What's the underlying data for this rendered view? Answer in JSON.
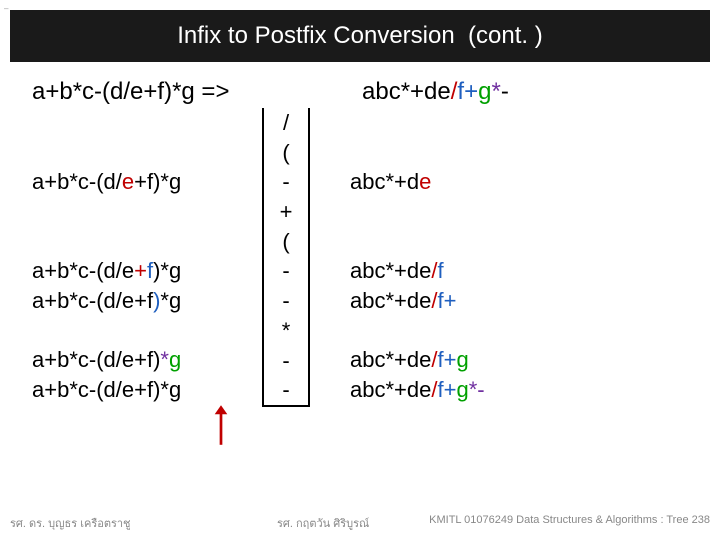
{
  "title": "Infix to Postfix Conversion  (cont. )",
  "tiny": "–",
  "header": {
    "expr_arrow": "a+b*c-(d/e+f)*g =>",
    "result_parts": [
      {
        "t": "abc*+de",
        "c": "hl-black"
      },
      {
        "t": "/",
        "c": "hl-red"
      },
      {
        "t": "f+",
        "c": "hl-blue"
      },
      {
        "t": "g",
        "c": "hl-green"
      },
      {
        "t": "*",
        "c": "hl-purple"
      },
      {
        "t": "-",
        "c": "hl-black"
      }
    ]
  },
  "rows": [
    {
      "left_parts": [],
      "stack": "/",
      "boxed": true,
      "right_parts": []
    },
    {
      "left_parts": [],
      "stack": "(",
      "boxed": true,
      "right_parts": []
    },
    {
      "left_parts": [
        {
          "t": "a+b*c-(d/",
          "c": "hl-black"
        },
        {
          "t": "e",
          "c": "hl-red"
        },
        {
          "t": "+f)*g",
          "c": "hl-black"
        }
      ],
      "stack": "-",
      "boxed": true,
      "right_parts": [
        {
          "t": "abc*+d",
          "c": "hl-black"
        },
        {
          "t": "e",
          "c": "hl-red"
        }
      ]
    },
    {
      "left_parts": [],
      "stack": "+",
      "boxed": true,
      "right_parts": []
    },
    {
      "left_parts": [],
      "stack": "(",
      "boxed": true,
      "right_parts": []
    },
    {
      "left_parts": [
        {
          "t": "a+b*c-(d/e",
          "c": "hl-black"
        },
        {
          "t": "+",
          "c": "hl-red"
        },
        {
          "t": "f",
          "c": "hl-blue"
        },
        {
          "t": ")*g",
          "c": "hl-black"
        }
      ],
      "stack": "-",
      "boxed": true,
      "right_parts": [
        {
          "t": "abc*+de",
          "c": "hl-black"
        },
        {
          "t": "/",
          "c": "hl-red"
        },
        {
          "t": "f",
          "c": "hl-blue"
        }
      ]
    },
    {
      "left_parts": [
        {
          "t": "a+b*c-(d/e+f",
          "c": "hl-black"
        },
        {
          "t": ")",
          "c": "hl-blue"
        },
        {
          "t": "*g",
          "c": "hl-black"
        }
      ],
      "stack": "-",
      "boxed": true,
      "right_parts": [
        {
          "t": "abc*+de",
          "c": "hl-black"
        },
        {
          "t": "/",
          "c": "hl-red"
        },
        {
          "t": "f",
          "c": "hl-blue"
        },
        {
          "t": "+",
          "c": "hl-blue"
        }
      ]
    },
    {
      "left_parts": [],
      "stack": "*",
      "boxed": true,
      "right_parts": []
    },
    {
      "left_parts": [
        {
          "t": "a+b*c-(d/e+f)",
          "c": "hl-black"
        },
        {
          "t": "*",
          "c": "hl-purple"
        },
        {
          "t": "g",
          "c": "hl-green"
        }
      ],
      "stack": "-",
      "boxed": true,
      "right_parts": [
        {
          "t": "abc*+de",
          "c": "hl-black"
        },
        {
          "t": "/",
          "c": "hl-red"
        },
        {
          "t": "f+",
          "c": "hl-blue"
        },
        {
          "t": "g",
          "c": "hl-green"
        }
      ]
    },
    {
      "left_parts": [
        {
          "t": "a+b*c-(d/e+f)*g",
          "c": "hl-black"
        }
      ],
      "stack": "-",
      "boxed": true,
      "boxbottom": true,
      "right_parts": [
        {
          "t": "abc*+de",
          "c": "hl-black"
        },
        {
          "t": "/",
          "c": "hl-red"
        },
        {
          "t": "f+",
          "c": "hl-blue"
        },
        {
          "t": "g",
          "c": "hl-green"
        },
        {
          "t": "*-",
          "c": "hl-purple"
        }
      ]
    }
  ],
  "footer": {
    "left": "รศ. ดร. บุญธร     เครือตราชู",
    "mid": "รศ. กฤตวัน   ศิริบูรณ์",
    "right": "KMITL   01076249 Data Structures & Algorithms : Tree 238"
  }
}
